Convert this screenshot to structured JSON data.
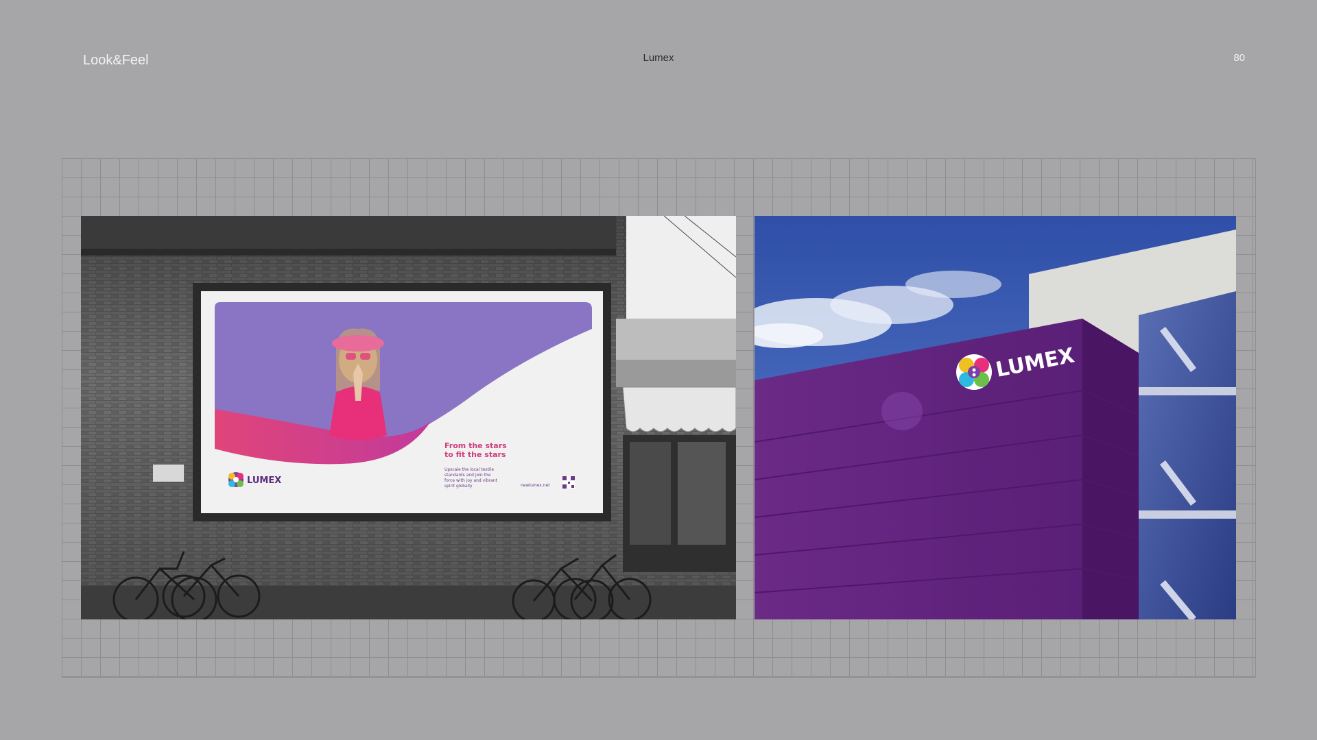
{
  "header": {
    "section_title": "Look&Feel",
    "brand": "Lumex",
    "page_number": "80"
  },
  "billboard": {
    "headline_line1": "From the stars",
    "headline_line2": "to fit the stars",
    "body_line1": "Upscale the local textile",
    "body_line2": "standards and join the",
    "body_line3": "force with joy and vibrant",
    "body_line4": "spirit globally",
    "url": "newlumex.net",
    "logo_text": "LUMEX"
  },
  "building": {
    "logo_text": "LUMEX"
  },
  "colors": {
    "background": "#a6a6a8",
    "brand_purple": "#6a2a86",
    "brand_pink": "#e2478a",
    "billboard_lilac": "#8a74c4"
  }
}
